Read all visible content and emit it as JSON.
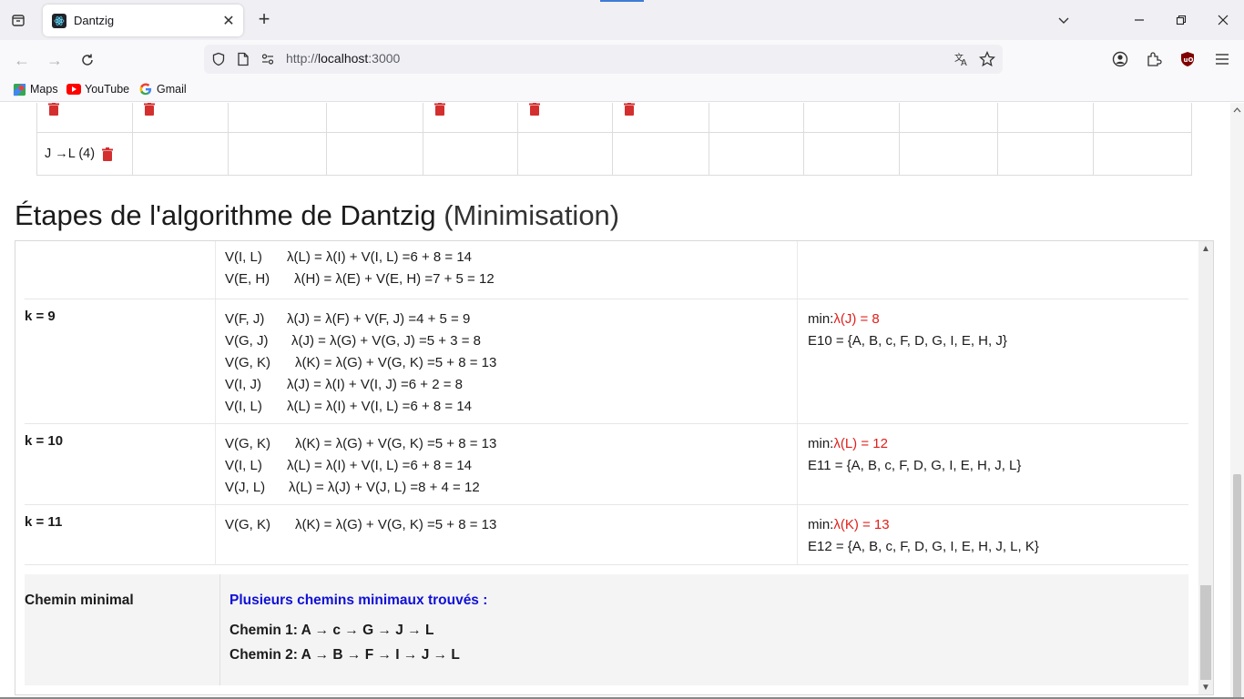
{
  "browser": {
    "tab_title": "Dantzig",
    "url_host": "localhost",
    "url_prefix": "http://",
    "url_port": ":3000",
    "bookmarks": [
      "Maps",
      "YouTube",
      "Gmail"
    ]
  },
  "table": {
    "row2_first_cell": "J →L (4)"
  },
  "section": {
    "title": "Étapes de l'algorithme de Dantzig",
    "subtitle": "(Minimisation)"
  },
  "steps": {
    "partial": {
      "lines": [
        {
          "v": "V(I, L)",
          "eq": "λ(L) = λ(I) + V(I, L) =6 + 8 = 14"
        },
        {
          "v": "V(E, H)",
          "eq": "λ(H) = λ(E) + V(E, H) =7 + 5 = 12"
        }
      ]
    },
    "k9": {
      "label": "k = 9",
      "lines": [
        {
          "v": "V(F, J)",
          "eq": "λ(J) = λ(F) + V(F, J) =4 + 5 = 9"
        },
        {
          "v": "V(G, J)",
          "eq": "λ(J) = λ(G) + V(G, J) =5 + 3 = 8"
        },
        {
          "v": "V(G, K)",
          "eq": "λ(K) = λ(G) + V(G, K) =5 + 8 = 13"
        },
        {
          "v": "V(I, J)",
          "eq": "λ(J) = λ(I) + V(I, J) =6 + 2 = 8"
        },
        {
          "v": "V(I, L)",
          "eq": "λ(L) = λ(I) + V(I, L) =6 + 8 = 14"
        }
      ],
      "min_prefix": "min:",
      "min_value": "λ(J) = 8",
      "set": "E10 = {A, B, c, F, D, G, I, E, H, J}"
    },
    "k10": {
      "label": "k = 10",
      "lines": [
        {
          "v": "V(G, K)",
          "eq": "λ(K) = λ(G) + V(G, K) =5 + 8 = 13"
        },
        {
          "v": "V(I, L)",
          "eq": "λ(L) = λ(I) + V(I, L) =6 + 8 = 14"
        },
        {
          "v": "V(J, L)",
          "eq": "λ(L) = λ(J) + V(J, L) =8 + 4 = 12"
        }
      ],
      "min_prefix": "min:",
      "min_value": "λ(L) = 12",
      "set": "E11 = {A, B, c, F, D, G, I, E, H, J, L}"
    },
    "k11": {
      "label": "k = 11",
      "lines": [
        {
          "v": "V(G, K)",
          "eq": "λ(K) = λ(G) + V(G, K) =5 + 8 = 13"
        }
      ],
      "min_prefix": "min:",
      "min_value": "λ(K) = 13",
      "set": "E12 = {A, B, c, F, D, G, I, E, H, J, L, K}"
    }
  },
  "minimal": {
    "label": "Chemin minimal",
    "found": "Plusieurs chemins minimaux trouvés :",
    "path1": "Chemin 1: A → c → G → J → L",
    "path2": "Chemin 2: A → B → F → I → J → L"
  },
  "colors": {
    "accent_red": "#e0201b",
    "found_blue": "#1010d8",
    "trash": "#d32f2f"
  }
}
